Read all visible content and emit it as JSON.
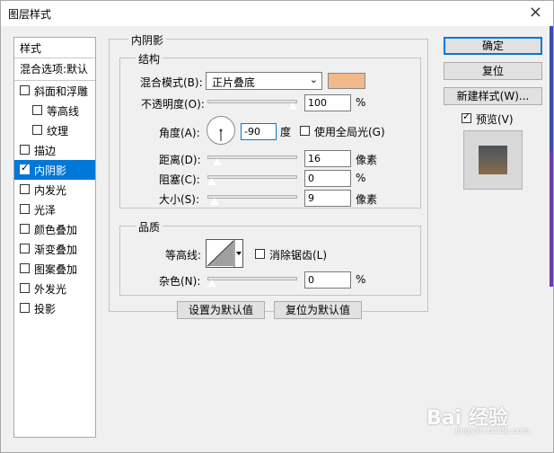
{
  "window": {
    "title": "图层样式",
    "close": "×"
  },
  "sidebar": {
    "header": "样式",
    "blend_options": "混合选项:默认",
    "items": [
      {
        "label": "斜面和浮雕",
        "checked": false
      },
      {
        "label": "等高线",
        "checked": false,
        "sub": true
      },
      {
        "label": "纹理",
        "checked": false,
        "sub": true
      },
      {
        "label": "描边",
        "checked": false
      },
      {
        "label": "内阴影",
        "checked": true,
        "selected": true
      },
      {
        "label": "内发光",
        "checked": false
      },
      {
        "label": "光泽",
        "checked": false
      },
      {
        "label": "颜色叠加",
        "checked": false
      },
      {
        "label": "渐变叠加",
        "checked": false
      },
      {
        "label": "图案叠加",
        "checked": false
      },
      {
        "label": "外发光",
        "checked": false
      },
      {
        "label": "投影",
        "checked": false
      }
    ]
  },
  "panel": {
    "title": "内阴影",
    "structure": {
      "title": "结构",
      "blend_mode_label": "混合模式(B):",
      "blend_mode_value": "正片叠底",
      "shadow_color": "#f2b98a",
      "opacity_label": "不透明度(O):",
      "opacity_value": "100",
      "opacity_unit": "%",
      "opacity_level": 1.0,
      "angle_label": "角度(A):",
      "angle_value": "-90",
      "angle_unit": "度",
      "global_light_label": "使用全局光(G)",
      "global_light_checked": false,
      "distance_label": "距离(D):",
      "distance_value": "16",
      "distance_unit": "像素",
      "distance_level": 0.064,
      "choke_label": "阻塞(C):",
      "choke_value": "0",
      "choke_unit": "%",
      "choke_level": 0.0,
      "size_label": "大小(S):",
      "size_value": "9",
      "size_unit": "像素",
      "size_level": 0.036
    },
    "quality": {
      "title": "品质",
      "contour_label": "等高线:",
      "antialias_label": "消除锯齿(L)",
      "antialias_checked": false,
      "noise_label": "杂色(N):",
      "noise_value": "0",
      "noise_unit": "%",
      "noise_level": 0.0
    },
    "make_default": "设置为默认值",
    "reset_default": "复位为默认值"
  },
  "buttons": {
    "ok": "确定",
    "reset": "复位",
    "new_style": "新建样式(W)...",
    "preview_label": "预览(V)",
    "preview_checked": true
  },
  "watermark": {
    "text": "Bai 经验",
    "sub": "jingyan.baidu.com"
  }
}
